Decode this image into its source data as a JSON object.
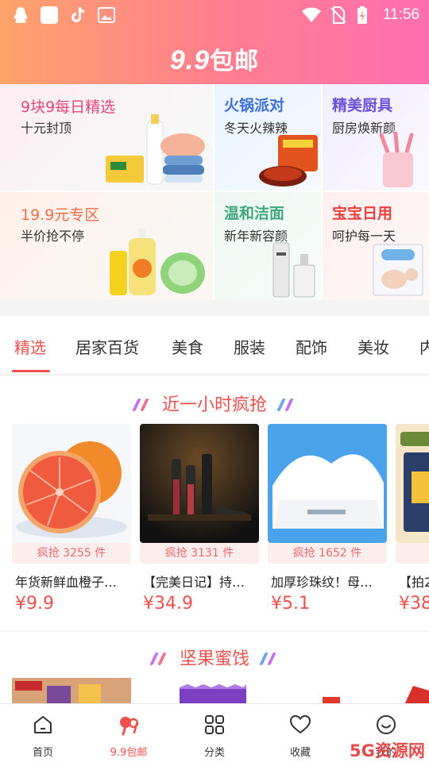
{
  "status_bar": {
    "time": "11:56"
  },
  "header": {
    "logo_number": "9.9",
    "logo_text": "包邮"
  },
  "banner": [
    {
      "title": "9块9每日精选",
      "subtitle": "十元封顶",
      "title_color": "#e8457a"
    },
    {
      "title": "火锅派对",
      "subtitle": "冬天火辣辣",
      "title_color": "#3d6fd8"
    },
    {
      "title": "精美厨具",
      "subtitle": "厨房焕新颜",
      "title_color": "#6a52d8"
    },
    {
      "title": "19.9元专区",
      "subtitle": "半价抢不停",
      "title_color": "#f06b4a"
    },
    {
      "title": "温和洁面",
      "subtitle": "新年新容颜",
      "title_color": "#3ea77d"
    },
    {
      "title": "宝宝日用",
      "subtitle": "呵护每一天",
      "title_color": "#e8413f"
    }
  ],
  "tabs": [
    "精选",
    "居家百货",
    "美食",
    "服装",
    "配饰",
    "美妆",
    "内"
  ],
  "active_tab": 0,
  "sections": [
    {
      "title": "近一小时疯抢",
      "products": [
        {
          "flash": "疯抢 3255 件",
          "name": "年货新鲜血橙子…",
          "price": "¥9.9"
        },
        {
          "flash": "疯抢 3131 件",
          "name": "【完美日记】持…",
          "price": "¥34.9"
        },
        {
          "flash": "疯抢 1652 件",
          "name": "加厚珍珠纹！母…",
          "price": "¥5.1"
        },
        {
          "flash": "疯",
          "name": "【拍2",
          "price": "¥38"
        }
      ]
    },
    {
      "title": "坚果蜜饯"
    }
  ],
  "bottom_nav": [
    {
      "label": "首页",
      "icon": "home-icon"
    },
    {
      "label": "9.9包邮",
      "icon": "nine-nine-icon"
    },
    {
      "label": "分类",
      "icon": "grid-icon"
    },
    {
      "label": "收藏",
      "icon": "heart-icon"
    },
    {
      "label": "我的",
      "icon": "profile-icon"
    }
  ],
  "active_nav": 1,
  "watermark": "5G资源网",
  "colors": {
    "accent": "#f0504d",
    "header_start": "#ffa36b",
    "header_end": "#ff6fb0"
  }
}
